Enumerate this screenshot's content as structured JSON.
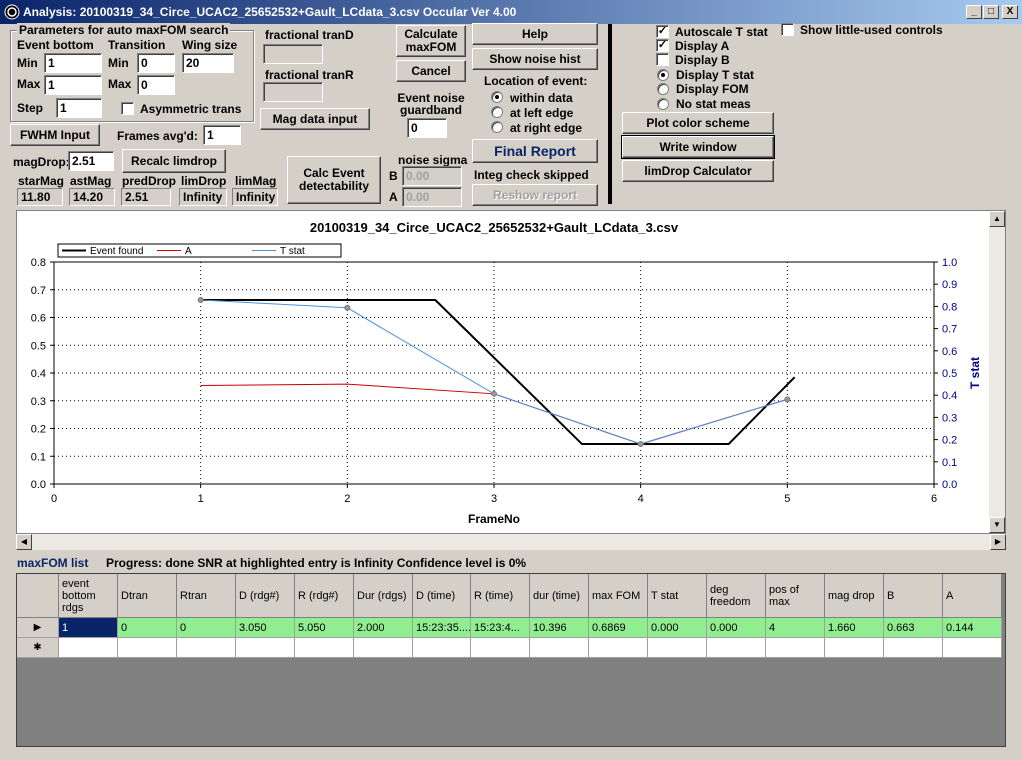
{
  "window": {
    "title": "Analysis: 20100319_34_Circe_UCAC2_25652532+Gault_LCdata_3.csv  Occular Ver 4.00",
    "minimize": "_",
    "maximize": "□",
    "close": "X"
  },
  "params": {
    "group_title": "Parameters for auto maxFOM search",
    "event_bottom": "Event bottom",
    "transition": "Transition",
    "wing_size": "Wing size",
    "min_label": "Min",
    "max_label": "Max",
    "step_label": "Step",
    "eb_min": "1",
    "eb_max": "1",
    "eb_step": "1",
    "tr_min": "0",
    "tr_max": "0",
    "wing": "20",
    "asymmetric": "Asymmetric trans"
  },
  "frac": {
    "tranD_label": "fractional tranD",
    "tranR_label": "fractional tranR",
    "tranD": "",
    "tranR": ""
  },
  "buttons": {
    "calculate": "Calculate maxFOM",
    "cancel": "Cancel",
    "help": "Help",
    "noise_hist": "Show noise hist",
    "fwhm": "FWHM Input",
    "mag_data": "Mag data input",
    "recalc": "Recalc limdrop",
    "calc_event": "Calc Event detectability",
    "final_report": "Final Report",
    "reshow": "Reshow report",
    "plot_color": "Plot color scheme",
    "write_window": "Write window",
    "limdrop_calc": "limDrop Calculator"
  },
  "frames_avgd": {
    "label": "Frames avg'd:",
    "value": "1"
  },
  "magdrop": {
    "label": "magDrop:",
    "value": "2.51"
  },
  "mags": {
    "starMag": {
      "label": "starMag",
      "value": "11.80"
    },
    "astMag": {
      "label": "astMag",
      "value": "14.20"
    },
    "predDrop": {
      "label": "predDrop",
      "value": "2.51"
    },
    "limDrop": {
      "label": "limDrop",
      "value": "Infinity"
    },
    "limMag": {
      "label": "limMag",
      "value": "Infinity"
    }
  },
  "guard": {
    "label": "Event noise guardband",
    "value": "0"
  },
  "location": {
    "label": "Location of event:",
    "options": [
      "within data",
      "at left edge",
      "at right edge"
    ],
    "selected": "within data"
  },
  "noise": {
    "label": "noise sigma",
    "b_label": "B",
    "a_label": "A",
    "b_value": "0.00",
    "a_value": "0.00"
  },
  "integ": "Integ check skipped",
  "display": {
    "autoscale": "Autoscale T stat",
    "display_a": "Display A",
    "display_b": "Display B",
    "show_little": "Show little-used controls",
    "stat_options": [
      "Display T stat",
      "Display FOM",
      "No stat meas"
    ],
    "stat_selected": "Display T stat"
  },
  "chart_data": {
    "type": "line",
    "title": "20100319_34_Circe_UCAC2_25652532+Gault_LCdata_3.csv",
    "xlabel": "FrameNo",
    "ylabel": "",
    "y2label": "T stat",
    "xlim": [
      0,
      6
    ],
    "ylim": [
      0,
      0.8
    ],
    "y2lim": [
      0,
      1
    ],
    "xticks": [
      "0",
      "1",
      "2",
      "3",
      "4",
      "5",
      "6"
    ],
    "yticks": [
      "0.0",
      "0.1",
      "0.2",
      "0.3",
      "0.4",
      "0.5",
      "0.6",
      "0.7",
      "0.8"
    ],
    "y2ticks": [
      "0.0",
      "0.1",
      "0.2",
      "0.3",
      "0.4",
      "0.5",
      "0.6",
      "0.7",
      "0.8",
      "0.9",
      "1.0"
    ],
    "legend_position": "top-left",
    "series": [
      {
        "name": "Event found",
        "color": "#000000",
        "axis": "left",
        "x": [
          1,
          2.6,
          3.6,
          4.6,
          5.05
        ],
        "y": [
          0.663,
          0.663,
          0.144,
          0.144,
          0.385
        ]
      },
      {
        "name": "A",
        "color": "#cc0000",
        "axis": "left",
        "x": [
          1,
          2,
          3,
          4,
          5
        ],
        "y": [
          0.355,
          0.36,
          0.325,
          0.144,
          0.305
        ]
      },
      {
        "name": "T stat",
        "color": "#4a90d9",
        "axis": "left",
        "markers": true,
        "x": [
          1,
          2,
          3,
          4,
          5
        ],
        "y": [
          0.663,
          0.635,
          0.325,
          0.144,
          0.305
        ]
      }
    ],
    "grid": true
  },
  "status": {
    "list_label": "maxFOM list",
    "progress": "Progress: done  SNR at highlighted entry is Infinity    Confidence level is  0%"
  },
  "table": {
    "headers": [
      "event bottom rdgs",
      "Dtran",
      "Rtran",
      "D (rdg#)",
      "R (rdg#)",
      "Dur (rdgs)",
      "D (time)",
      "R (time)",
      "dur (time)",
      "max FOM",
      "T stat",
      "deg freedom",
      "pos of max",
      "mag drop",
      "B",
      "A"
    ],
    "rows": [
      [
        "1",
        "0",
        "0",
        "3.050",
        "5.050",
        "2.000",
        "15:23:35....",
        "15:23:4...",
        "10.396",
        "0.6869",
        "0.000",
        "0.000",
        "4",
        "1.660",
        "0.663",
        "0.144"
      ]
    ],
    "row_marker": "▶",
    "new_marker": "✱"
  }
}
